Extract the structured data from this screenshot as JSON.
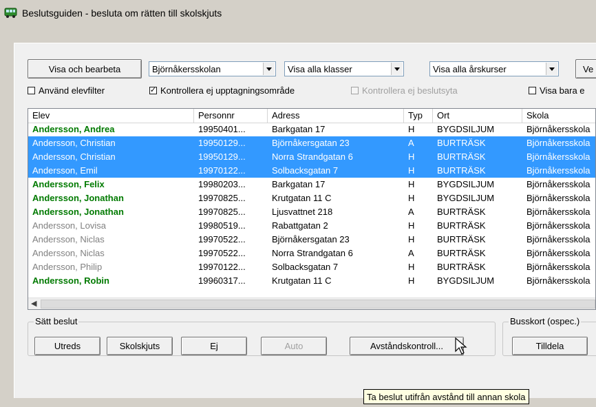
{
  "window": {
    "title": "Beslutsguiden - besluta om rätten till skolskjuts",
    "icon": "bus-icon",
    "colors": {
      "selection": "#3399ff",
      "green_name": "#007a00",
      "gray_name": "#808080",
      "tooltip_bg": "#ffffe1"
    }
  },
  "toolbar": {
    "show_edit_label": "Visa och bearbeta",
    "school_select": "Björnåkersskolan",
    "class_select": "Visa alla klasser",
    "grade_select": "Visa alla årskurser",
    "right_button_label": "Ve"
  },
  "filters": {
    "student_filter": {
      "label": "Använd elevfilter",
      "checked": false
    },
    "no_pickup_area": {
      "label": "Kontrollera ej upptagningsområde",
      "checked": true
    },
    "no_decision_area": {
      "label": "Kontrollera ej beslutsyta",
      "checked": false,
      "disabled": true
    },
    "show_only": {
      "label": "Visa bara e",
      "checked": false
    }
  },
  "table": {
    "columns": [
      "Elev",
      "Personnr",
      "Adress",
      "Typ",
      "Ort",
      "Skola"
    ],
    "rows": [
      {
        "elev": "Andersson, Andrea",
        "personnr": "19950401...",
        "adress": "Barkgatan 17",
        "typ": "H",
        "ort": "BYGDSILJUM",
        "skola": "Björnåkersskola",
        "style": "green",
        "selected": false
      },
      {
        "elev": "Andersson, Christian",
        "personnr": "19950129...",
        "adress": "Björnåkersgatan 23",
        "typ": "A",
        "ort": "BURTRÄSK",
        "skola": "Björnåkersskola",
        "style": "gray",
        "selected": true
      },
      {
        "elev": "Andersson, Christian",
        "personnr": "19950129...",
        "adress": "Norra Strandgatan 6",
        "typ": "H",
        "ort": "BURTRÄSK",
        "skola": "Björnåkersskola",
        "style": "gray",
        "selected": true
      },
      {
        "elev": "Andersson, Emil",
        "personnr": "19970122...",
        "adress": "Solbacksgatan 7",
        "typ": "H",
        "ort": "BURTRÄSK",
        "skola": "Björnåkersskola",
        "style": "gray",
        "selected": true
      },
      {
        "elev": "Andersson, Felix",
        "personnr": "19980203...",
        "adress": "Barkgatan 17",
        "typ": "H",
        "ort": "BYGDSILJUM",
        "skola": "Björnåkersskola",
        "style": "green",
        "selected": false
      },
      {
        "elev": "Andersson, Jonathan",
        "personnr": "19970825...",
        "adress": "Krutgatan 11 C",
        "typ": "H",
        "ort": "BYGDSILJUM",
        "skola": "Björnåkersskola",
        "style": "green",
        "selected": false
      },
      {
        "elev": "Andersson, Jonathan",
        "personnr": "19970825...",
        "adress": "Ljusvattnet 218",
        "typ": "A",
        "ort": "BURTRÄSK",
        "skola": "Björnåkersskola",
        "style": "green",
        "selected": false
      },
      {
        "elev": "Andersson, Lovisa",
        "personnr": "19980519...",
        "adress": "Rabattgatan 2",
        "typ": "H",
        "ort": "BURTRÄSK",
        "skola": "Björnåkersskola",
        "style": "gray",
        "selected": false
      },
      {
        "elev": "Andersson, Niclas",
        "personnr": "19970522...",
        "adress": "Björnåkersgatan 23",
        "typ": "H",
        "ort": "BURTRÄSK",
        "skola": "Björnåkersskola",
        "style": "gray",
        "selected": false
      },
      {
        "elev": "Andersson, Niclas",
        "personnr": "19970522...",
        "adress": "Norra Strandgatan 6",
        "typ": "A",
        "ort": "BURTRÄSK",
        "skola": "Björnåkersskola",
        "style": "gray",
        "selected": false
      },
      {
        "elev": "Andersson, Philip",
        "personnr": "19970122...",
        "adress": "Solbacksgatan 7",
        "typ": "H",
        "ort": "BURTRÄSK",
        "skola": "Björnåkersskola",
        "style": "gray",
        "selected": false
      },
      {
        "elev": "Andersson, Robin",
        "personnr": "19960317...",
        "adress": "Krutgatan 11 C",
        "typ": "H",
        "ort": "BYGDSILJUM",
        "skola": "Björnåkersskola",
        "style": "green",
        "selected": false
      }
    ]
  },
  "decision": {
    "legend": "Sätt beslut",
    "utreds": "Utreds",
    "skolskjuts": "Skolskjuts",
    "ej": "Ej",
    "auto": "Auto",
    "distance_check": "Avståndskontroll..."
  },
  "buscard": {
    "legend": "Busskort (ospec.)",
    "assign": "Tilldela"
  },
  "tooltip": "Ta beslut utifrån avstånd till annan skola"
}
